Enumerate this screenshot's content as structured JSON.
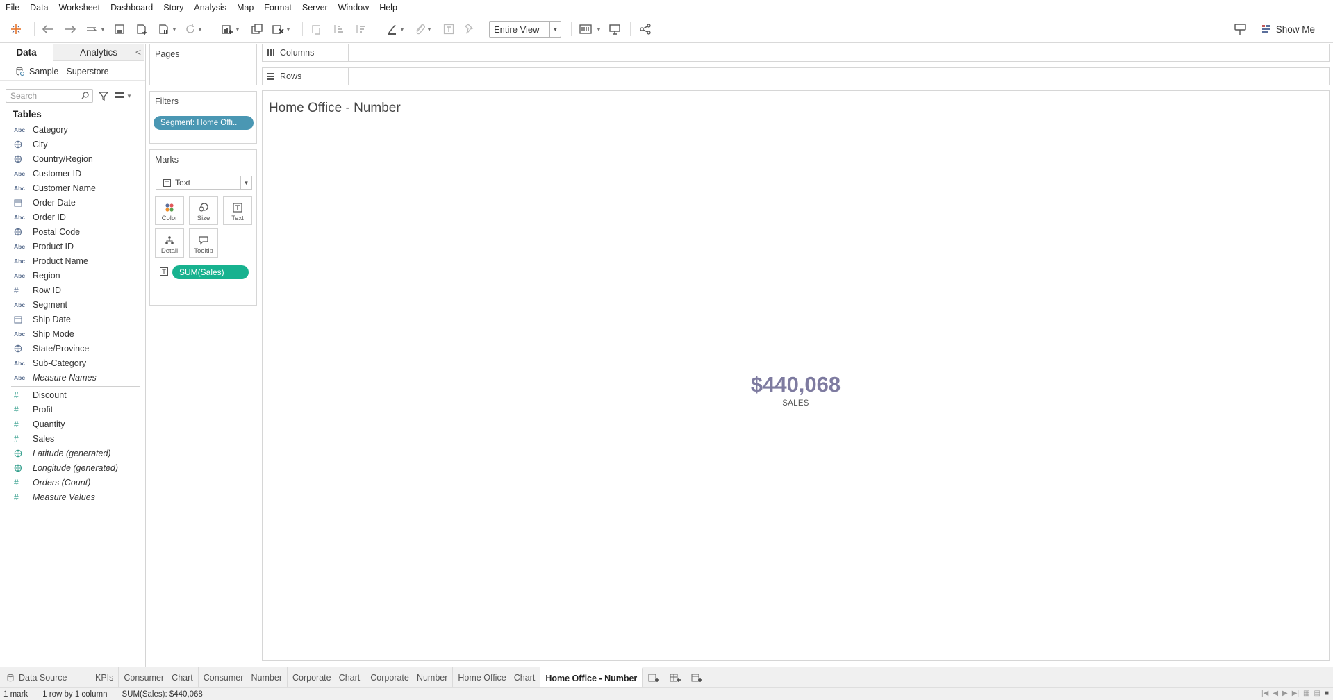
{
  "menu": [
    "File",
    "Data",
    "Worksheet",
    "Dashboard",
    "Story",
    "Analysis",
    "Map",
    "Format",
    "Server",
    "Window",
    "Help"
  ],
  "toolbar": {
    "view_mode": "Entire View",
    "show_me": "Show Me",
    "icons": [
      "tableau-logo-icon",
      "undo-icon",
      "redo-icon",
      "replay-icon",
      "save-icon",
      "new-datasource-icon",
      "pause-updates-icon",
      "refresh-icon",
      "new-worksheet-icon",
      "duplicate-sheet-icon",
      "clear-sheet-icon",
      "swap-icon",
      "sort-ascending-icon",
      "sort-descending-icon",
      "highlight-icon",
      "group-icon",
      "label-icon",
      "pin-icon",
      "fit-icon",
      "presentation-icon",
      "share-icon",
      "tooltip-icon"
    ]
  },
  "datapane": {
    "tab_data": "Data",
    "tab_analytics": "Analytics",
    "datasource": "Sample - Superstore",
    "search_placeholder": "Search",
    "tables_heading": "Tables",
    "dimensions": [
      {
        "type": "Abc",
        "name": "Category",
        "italic": false
      },
      {
        "type": "geo",
        "name": "City",
        "italic": false
      },
      {
        "type": "geo",
        "name": "Country/Region",
        "italic": false
      },
      {
        "type": "Abc",
        "name": "Customer ID",
        "italic": false
      },
      {
        "type": "Abc",
        "name": "Customer Name",
        "italic": false
      },
      {
        "type": "date",
        "name": "Order Date",
        "italic": false
      },
      {
        "type": "Abc",
        "name": "Order ID",
        "italic": false
      },
      {
        "type": "geo",
        "name": "Postal Code",
        "italic": false
      },
      {
        "type": "Abc",
        "name": "Product ID",
        "italic": false
      },
      {
        "type": "Abc",
        "name": "Product Name",
        "italic": false
      },
      {
        "type": "Abc",
        "name": "Region",
        "italic": false
      },
      {
        "type": "num",
        "name": "Row ID",
        "italic": false
      },
      {
        "type": "Abc",
        "name": "Segment",
        "italic": false
      },
      {
        "type": "date",
        "name": "Ship Date",
        "italic": false
      },
      {
        "type": "Abc",
        "name": "Ship Mode",
        "italic": false
      },
      {
        "type": "geo",
        "name": "State/Province",
        "italic": false
      },
      {
        "type": "Abc",
        "name": "Sub-Category",
        "italic": false
      },
      {
        "type": "Abc",
        "name": "Measure Names",
        "italic": true
      }
    ],
    "measures": [
      {
        "type": "num",
        "name": "Discount",
        "italic": false
      },
      {
        "type": "num",
        "name": "Profit",
        "italic": false
      },
      {
        "type": "num",
        "name": "Quantity",
        "italic": false
      },
      {
        "type": "num",
        "name": "Sales",
        "italic": false
      },
      {
        "type": "geo",
        "name": "Latitude (generated)",
        "italic": true
      },
      {
        "type": "geo",
        "name": "Longitude (generated)",
        "italic": true
      },
      {
        "type": "num",
        "name": "Orders (Count)",
        "italic": true
      },
      {
        "type": "num",
        "name": "Measure Values",
        "italic": true
      }
    ]
  },
  "cards": {
    "pages": "Pages",
    "filters": "Filters",
    "filter_pill": "Segment: Home Offi..",
    "marks": "Marks",
    "mark_type": "Text",
    "mark_buttons": [
      "Color",
      "Size",
      "Text",
      "Detail",
      "Tooltip"
    ],
    "text_pill": "SUM(Sales)"
  },
  "shelves": {
    "columns": "Columns",
    "rows": "Rows"
  },
  "view": {
    "title": "Home Office - Number",
    "value": "$440,068",
    "label": "SALES",
    "value_color": "#7e7ba0"
  },
  "tabs": {
    "data_source": "Data Source",
    "sheets": [
      "KPIs",
      "Consumer - Chart",
      "Consumer - Number",
      "Corporate - Chart",
      "Corporate - Number",
      "Home Office - Chart",
      "Home Office - Number"
    ],
    "active": "Home Office - Number"
  },
  "status": {
    "marks": "1 mark",
    "dims": "1 row by 1 column",
    "sum": "SUM(Sales): $440,068"
  },
  "colors": {
    "filter_pill": "#4a97b3",
    "measure_pill": "#17b28f"
  }
}
